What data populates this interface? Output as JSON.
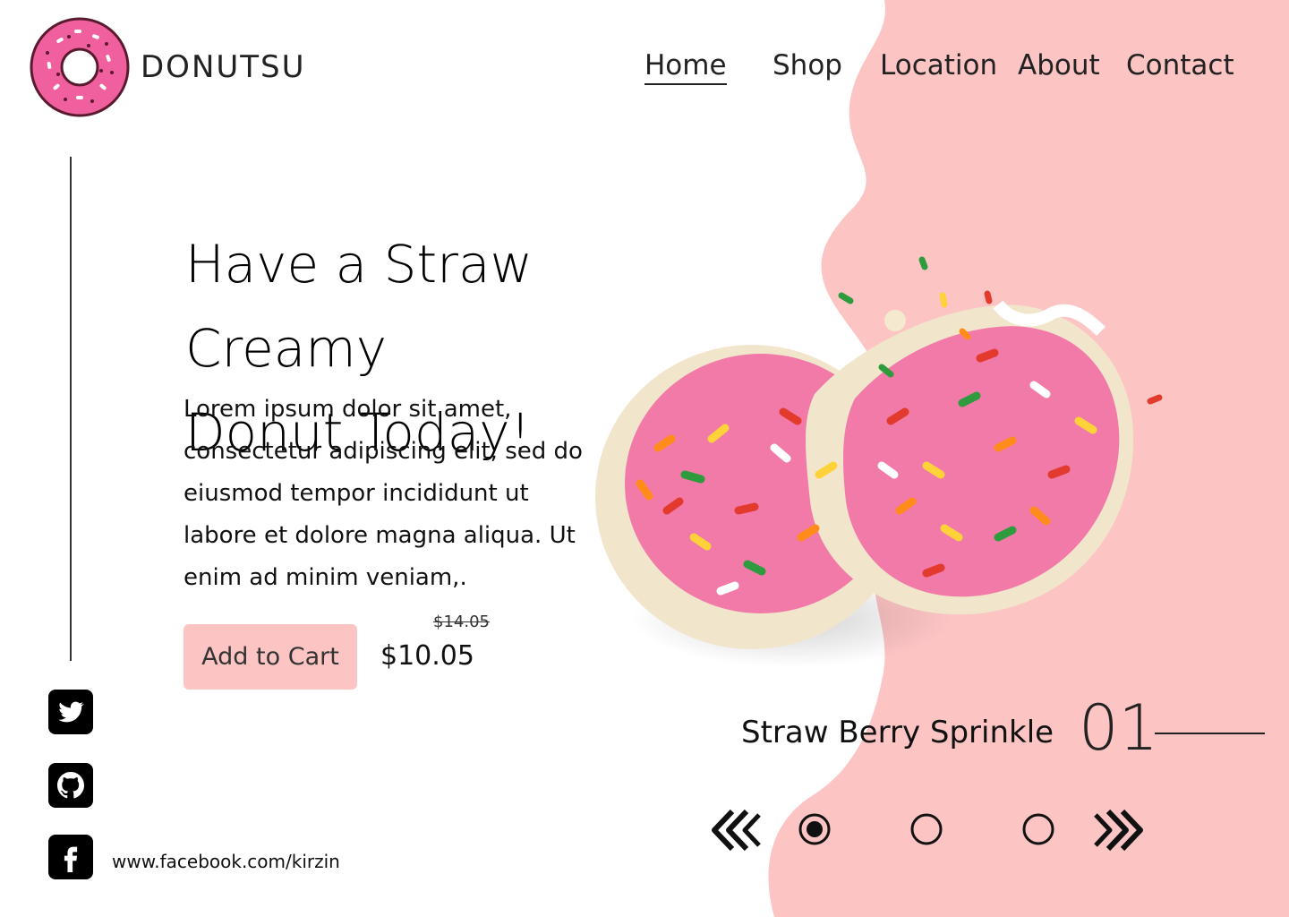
{
  "brand": {
    "name": "DONUTSU"
  },
  "nav": [
    "Home",
    "Shop",
    "Location",
    "About",
    "Contact"
  ],
  "nav_active": "Home",
  "hero": {
    "headline_line1": "Have a Straw Creamy",
    "headline_line2": "Donut Today!",
    "description": "Lorem ipsum dolor sit amet, consectetur adipiscing elit, sed do eiusmod tempor incididunt ut labore et dolore magna aliqua. Ut enim ad minim veniam,.",
    "add_to_cart": "Add to Cart",
    "old_price": "$14.05",
    "price": "$10.05"
  },
  "social": {
    "icons": [
      "twitter-icon",
      "github-icon",
      "facebook-icon"
    ],
    "facebook_url": "www.facebook.com/kirzin"
  },
  "product": {
    "name": "Straw Berry Sprinkle",
    "number": "01"
  },
  "carousel": {
    "slides": 3,
    "active_index": 0
  },
  "colors": {
    "accent_pink": "#fdc4c4",
    "text": "#111111",
    "donut_pink": "#f0609e"
  }
}
